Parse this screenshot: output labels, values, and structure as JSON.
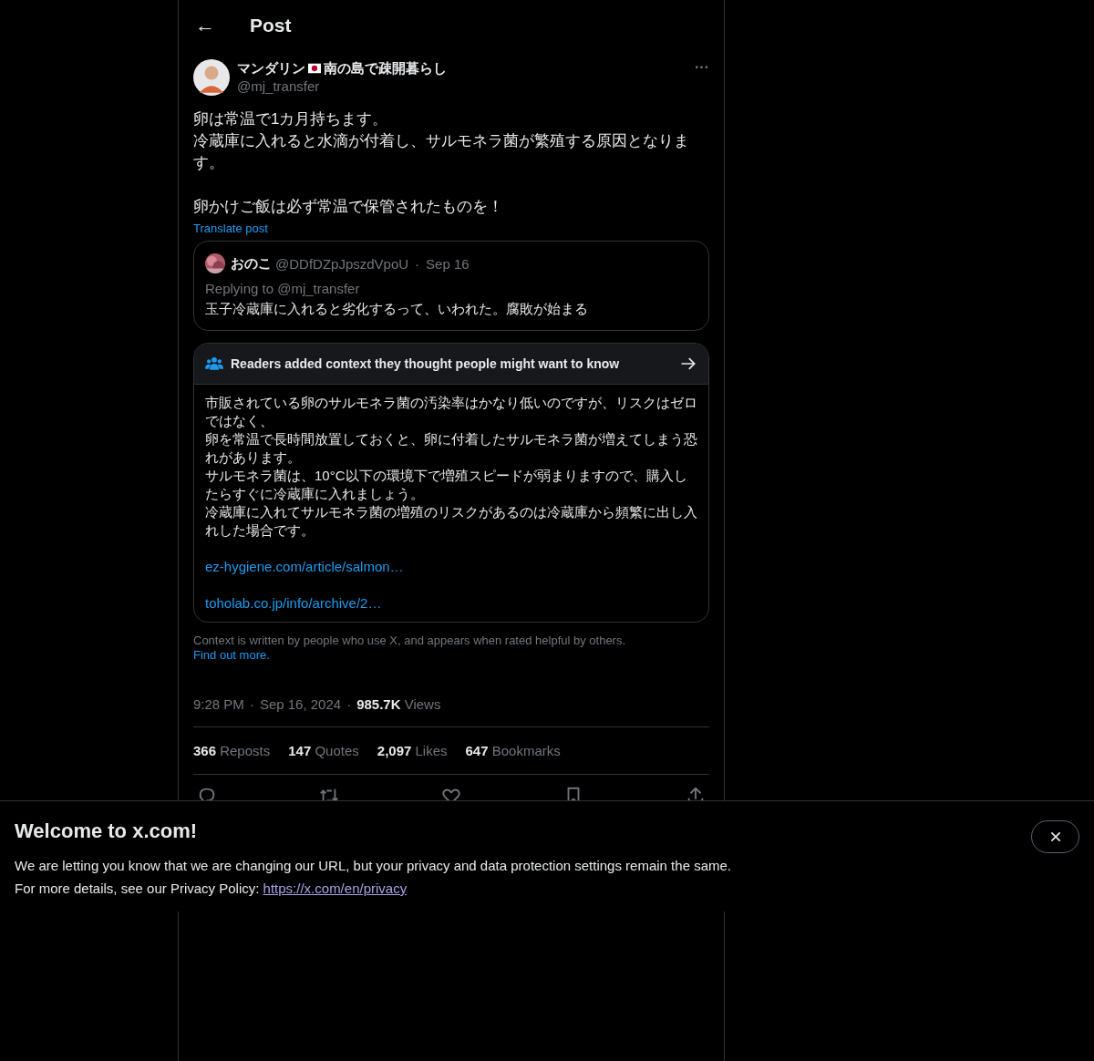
{
  "header": {
    "back_icon": "←",
    "title": "Post"
  },
  "post": {
    "author": {
      "name_before": "マンダリン",
      "name_after": "南の島で疎開暮らし",
      "handle": "@mj_transfer"
    },
    "more_icon": "···",
    "paragraphs": [
      {
        "lines": [
          "卵は常温で1カ月持ちます。",
          "冷蔵庫に入れると水滴が付着し、サルモネラ菌が繁殖する原因となります。"
        ]
      },
      {
        "lines": [
          "卵かけご飯は必ず常温で保管されたものを！"
        ]
      }
    ],
    "translate": "Translate post",
    "quote": {
      "name": "おのこ",
      "handle": "@DDfDZpJpszdVpoU",
      "separator": "·",
      "date": "Sep 16",
      "replying": "Replying to @mj_transfer",
      "text": "玉子冷蔵庫に入れると劣化するって、いわれた。腐敗が始まる"
    },
    "note": {
      "title": "Readers added context they thought people might want to know",
      "lines": [
        "市販されている卵のサルモネラ菌の汚染率はかなり低いのですが、リスクはゼロではなく、",
        "卵を常温で長時間放置しておくと、卵に付着したサルモネラ菌が増えてしまう恐れがあります。",
        "サルモネラ菌は、10°C以下の環境下で増殖スピードが弱まりますので、購入したらすぐに冷蔵庫に入れましょう。",
        "冷蔵庫に入れてサルモネラ菌の増殖のリスクがあるのは冷蔵庫から頻繁に出し入れした場合です。"
      ],
      "links": [
        "ez-hygiene.com/article/salmon…",
        "toholab.co.jp/info/archive/2…"
      ]
    },
    "note_footer": {
      "text": "Context is written by people who use X, and appears when rated helpful by others.",
      "link": "Find out more."
    },
    "meta": {
      "time": "9:28 PM",
      "date": "Sep 16, 2024",
      "views": "**985.7K** Views"
    },
    "separator": "·",
    "stats": [
      "**366** Reposts",
      "**147** Quotes",
      "**2,097** Likes",
      "**647** Bookmarks"
    ],
    "actions": [
      {
        "kind": "reply"
      },
      {
        "kind": "repost"
      },
      {
        "kind": "like"
      },
      {
        "kind": "bookmark"
      },
      {
        "kind": "share"
      }
    ]
  },
  "banner": {
    "title": "Welcome to x.com!",
    "line_1": "We are letting you know that we are changing our URL, but your privacy and data protection settings remain the same.",
    "line_2": "For more details, see our Privacy Policy:",
    "link": "https://x.com/en/privacy"
  }
}
